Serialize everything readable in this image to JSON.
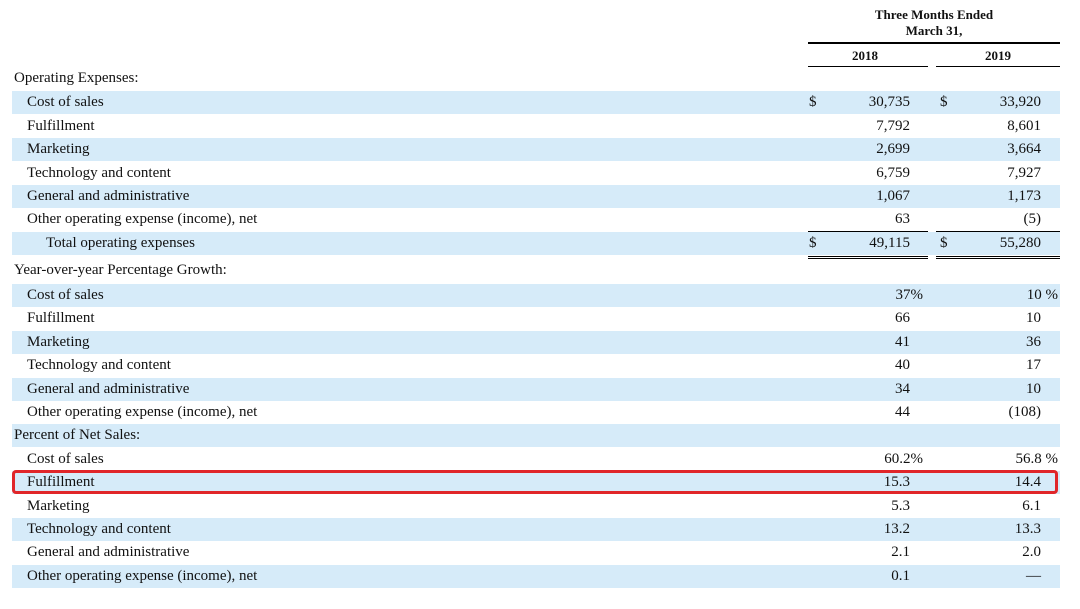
{
  "header": {
    "period_line1": "Three Months Ended",
    "period_line2": "March 31,",
    "year1": "2018",
    "year2": "2019"
  },
  "sections": {
    "operating_expenses": {
      "label": "Operating Expenses:",
      "rows": [
        {
          "label": "Cost of sales",
          "dollar1": "$",
          "v2018": "30,735",
          "dollar2": "$",
          "v2019": "33,920"
        },
        {
          "label": "Fulfillment",
          "v2018": "7,792",
          "v2019": "8,601"
        },
        {
          "label": "Marketing",
          "v2018": "2,699",
          "v2019": "3,664"
        },
        {
          "label": "Technology and content",
          "v2018": "6,759",
          "v2019": "7,927"
        },
        {
          "label": "General and administrative",
          "v2018": "1,067",
          "v2019": "1,173"
        },
        {
          "label": "Other operating expense (income), net",
          "v2018": "63",
          "v2019": "(5)"
        },
        {
          "label": "Total operating expenses",
          "dollar1": "$",
          "v2018": "49,115",
          "dollar2": "$",
          "v2019": "55,280"
        }
      ]
    },
    "yoy_growth": {
      "label": "Year-over-year Percentage Growth:",
      "rows": [
        {
          "label": "Cost of sales",
          "v2018": "37%",
          "v2019": "10 %"
        },
        {
          "label": "Fulfillment",
          "v2018": "66",
          "v2019": "10"
        },
        {
          "label": "Marketing",
          "v2018": "41",
          "v2019": "36"
        },
        {
          "label": "Technology and content",
          "v2018": "40",
          "v2019": "17"
        },
        {
          "label": "General and administrative",
          "v2018": "34",
          "v2019": "10"
        },
        {
          "label": "Other operating expense (income), net",
          "v2018": "44",
          "v2019": "(108)"
        }
      ]
    },
    "percent_net_sales": {
      "label": "Percent of Net Sales:",
      "rows": [
        {
          "label": "Cost of sales",
          "v2018": "60.2%",
          "v2019": "56.8 %"
        },
        {
          "label": "Fulfillment",
          "v2018": "15.3",
          "v2019": "14.4"
        },
        {
          "label": "Marketing",
          "v2018": "5.3",
          "v2019": "6.1"
        },
        {
          "label": "Technology and content",
          "v2018": "13.2",
          "v2019": "13.3"
        },
        {
          "label": "General and administrative",
          "v2018": "2.1",
          "v2019": "2.0"
        },
        {
          "label": "Other operating expense (income), net",
          "v2018": "0.1",
          "v2019": "—"
        }
      ]
    }
  },
  "colors": {
    "row_shade": "#d6ebf9",
    "highlight_border": "#e0262a"
  }
}
